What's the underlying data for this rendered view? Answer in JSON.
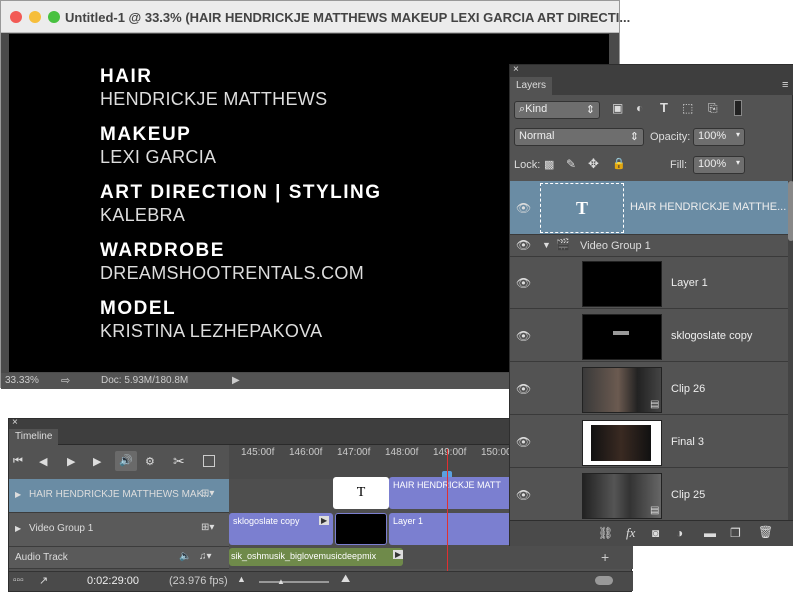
{
  "document": {
    "title": "Untitled-1 @ 33.3% (HAIR HENDRICKJE MATTHEWS  MAKEUP LEXI GARCIA  ART DIRECTI...",
    "credits": [
      {
        "heading": "HAIR",
        "name": "HENDRICKJE MATTHEWS"
      },
      {
        "heading": "MAKEUP",
        "name": "LEXI GARCIA"
      },
      {
        "heading": "ART DIRECTION | STYLING",
        "name": "KALEBRA"
      },
      {
        "heading": "WARDROBE",
        "name": "DREAMSHOOTRENTALS.COM"
      },
      {
        "heading": "MODEL",
        "name": "KRISTINA LEZHEPAKOVA"
      }
    ],
    "status": {
      "zoom": "33.33%",
      "doc_size": "Doc: 5.93M/180.8M",
      "arrow": "▶"
    }
  },
  "timeline": {
    "close": "×",
    "tab": "Timeline",
    "ruler_ticks": [
      "145:00f",
      "146:00f",
      "147:00f",
      "148:00f",
      "149:00f",
      "150:00"
    ],
    "tracks": {
      "text_layer": "HAIR  HENDRICKJE MATTHEWS  MAK...",
      "video_group": "Video Group 1",
      "audio": "Audio Track"
    },
    "clips": {
      "text_clip_label": "HAIR  HENDRICKJE MATT",
      "text_icon": "T",
      "clip_a": "sklogoslate copy",
      "clip_b": "Layer 1",
      "audio_clip": "sik_oshmusik_biglovemusicdeepmix"
    },
    "timecode": "0:02:29:00",
    "fps": "(23.976 fps)",
    "add": "+"
  },
  "layers_panel": {
    "close": "×",
    "tab": "Layers",
    "kind": "Kind",
    "blend_mode": "Normal",
    "opacity_label": "Opacity:",
    "opacity_value": "100%",
    "lock_label": "Lock:",
    "fill_label": "Fill:",
    "fill_value": "100%",
    "text_layer_name": "HAIR  HENDRICKJE MATTHE...",
    "text_thumb": "T",
    "group_name": "Video Group 1",
    "layers": [
      "Layer 1",
      "sklogoslate copy",
      "Clip 26",
      "Final 3",
      "Clip 25"
    ],
    "footer_fx": "fx"
  },
  "colors": {
    "selected_layer": "#6a8ca4",
    "clip_purple": "#7b7fd0",
    "audio_green": "#6f8a4a"
  }
}
